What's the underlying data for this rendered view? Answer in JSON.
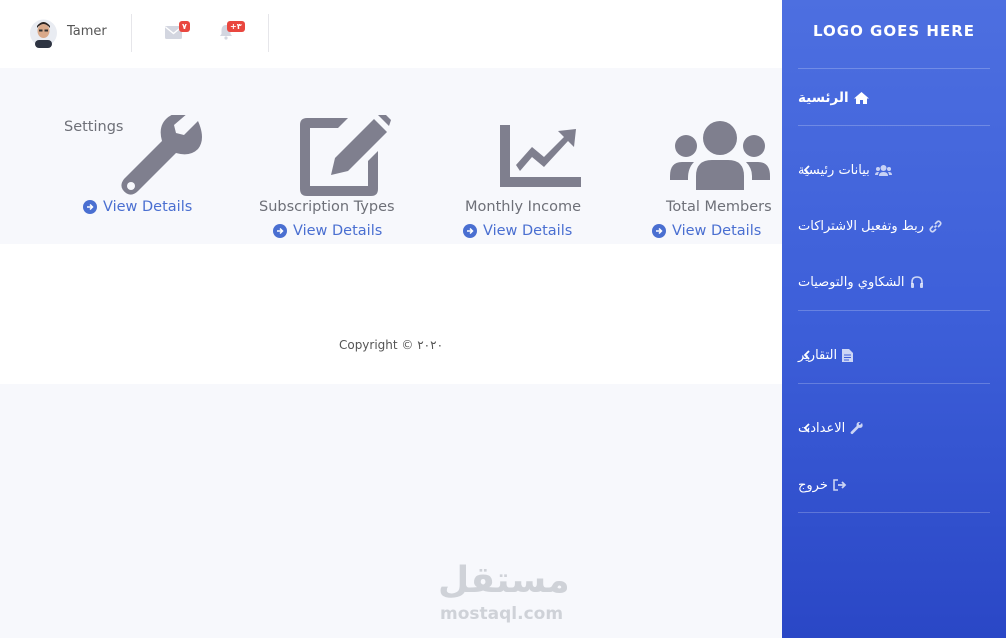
{
  "header": {
    "username": "Tamer",
    "mail_badge": "٧",
    "notif_badge": "+٣"
  },
  "cards": [
    {
      "title": "Settings",
      "link": "View Details",
      "icon": "wrench-icon"
    },
    {
      "title": "Subscription Types",
      "link": "View Details",
      "icon": "edit-icon"
    },
    {
      "title": "Monthly Income",
      "link": "View Details",
      "icon": "chart-line-icon"
    },
    {
      "title": "Total Members",
      "link": "View Details",
      "icon": "users-icon"
    }
  ],
  "footer": {
    "copyright": "Copyright © ٢٠٢٠"
  },
  "watermark": {
    "arabic": "مستقل",
    "latin": "mostaql.com"
  },
  "sidebar": {
    "logo": "LOGO GOES HERE",
    "items": [
      {
        "label": "الرئسية",
        "icon": "home-icon"
      },
      {
        "label": "بيانات رئيسية",
        "icon": "users-icon"
      },
      {
        "label": "ربط وتفعيل الاشتراكات",
        "icon": "link-icon"
      },
      {
        "label": "الشكاوي والتوصيات",
        "icon": "headset-icon"
      },
      {
        "label": "التقارير",
        "icon": "file-icon"
      },
      {
        "label": "الاعدادت",
        "icon": "wrench-icon"
      },
      {
        "label": "خروج",
        "icon": "sign-out-icon"
      }
    ]
  },
  "colors": {
    "accent": "#4a6fd1",
    "sidebar_top": "#4d6fe0",
    "sidebar_bottom": "#2a47c6",
    "icon_gray": "#7f7f8e",
    "badge_red": "#e9473f"
  }
}
